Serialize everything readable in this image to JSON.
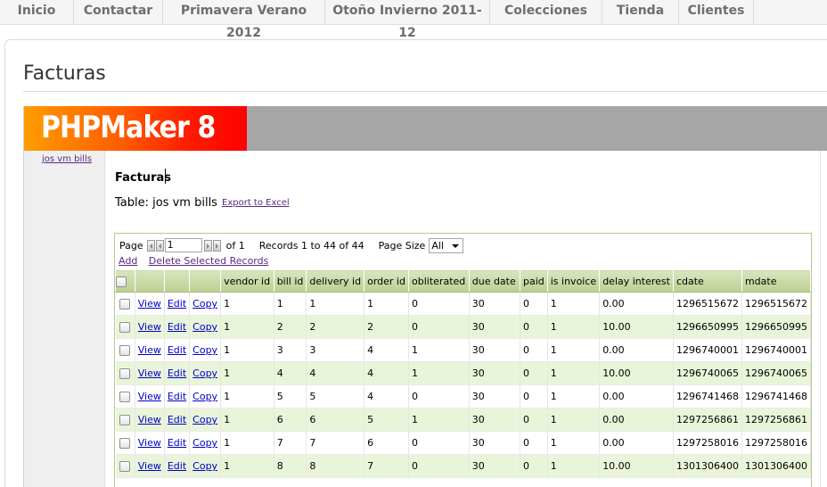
{
  "nav": {
    "items": [
      "Inicio",
      "Contactar",
      "Primavera Verano 2012",
      "Otoño Invierno 2011-12",
      "Colecciones",
      "Tienda",
      "Clientes"
    ]
  },
  "page": {
    "title": "Facturas"
  },
  "app": {
    "logo_text": "PHPMaker 8",
    "sidebar_link": "jos vm bills",
    "heading": "Facturas",
    "table_label": "Table: jos vm bills",
    "export_link": "Export to Excel"
  },
  "pager": {
    "page_label": "Page",
    "page_value": "1",
    "of_label": "of 1",
    "records": "Records 1 to 44 of 44",
    "page_size_label": "Page Size",
    "page_size_value": "All",
    "add_link": "Add",
    "delete_link": "Delete Selected Records"
  },
  "table": {
    "columns": [
      "vendor id",
      "bill id",
      "delivery id",
      "order id",
      "obliterated",
      "due date",
      "paid",
      "is invoice",
      "delay interest",
      "cdate",
      "mdate"
    ],
    "row_actions": [
      "View",
      "Edit",
      "Copy"
    ],
    "rows": [
      [
        "1",
        "1",
        "1",
        "1",
        "0",
        "30",
        "0",
        "1",
        "0.00",
        "1296515672",
        "1296515672"
      ],
      [
        "1",
        "2",
        "2",
        "2",
        "0",
        "30",
        "0",
        "1",
        "10.00",
        "1296650995",
        "1296650995"
      ],
      [
        "1",
        "3",
        "3",
        "4",
        "1",
        "30",
        "0",
        "1",
        "0.00",
        "1296740001",
        "1296740001"
      ],
      [
        "1",
        "4",
        "4",
        "4",
        "1",
        "30",
        "0",
        "1",
        "10.00",
        "1296740065",
        "1296740065"
      ],
      [
        "1",
        "5",
        "5",
        "4",
        "0",
        "30",
        "0",
        "1",
        "0.00",
        "1296741468",
        "1296741468"
      ],
      [
        "1",
        "6",
        "6",
        "5",
        "1",
        "30",
        "0",
        "1",
        "0.00",
        "1297256861",
        "1297256861"
      ],
      [
        "1",
        "7",
        "7",
        "6",
        "0",
        "30",
        "0",
        "1",
        "0.00",
        "1297258016",
        "1297258016"
      ],
      [
        "1",
        "8",
        "8",
        "7",
        "0",
        "30",
        "0",
        "1",
        "10.00",
        "1301306400",
        "1301306400"
      ]
    ]
  }
}
